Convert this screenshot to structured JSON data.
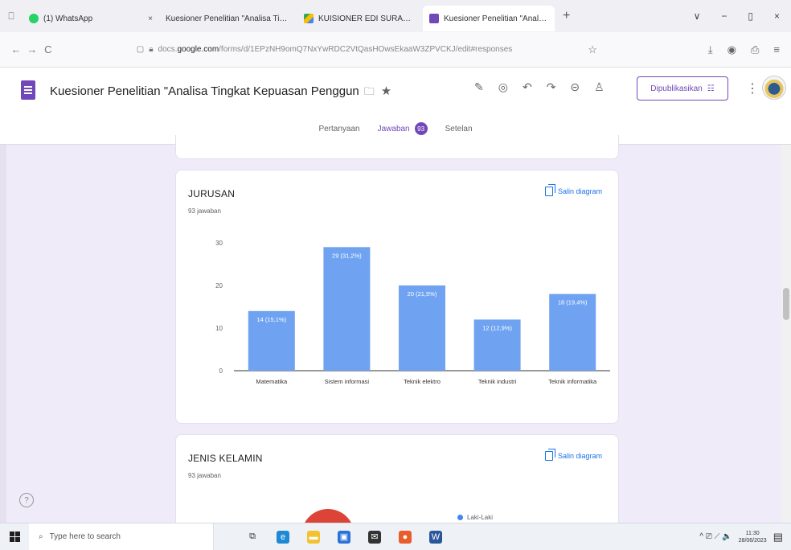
{
  "browser": {
    "tabs": [
      {
        "label": "(1) WhatsApp",
        "close": "×",
        "color": "#25d366",
        "active": false
      },
      {
        "label": "Kuesioner Penelitian \"Analisa Tingk: ×",
        "close": "",
        "color": "#ffffff",
        "active": false
      },
      {
        "label": "KUISIONER EDI SURADI - Goog ×",
        "close": "",
        "color": "#34a853",
        "active": false
      },
      {
        "label": "Kuesioner Penelitian \"Analisa Ti ×",
        "close": "",
        "color": "#7248b9",
        "active": true
      }
    ],
    "new_tab": "+",
    "window_controls": [
      "∨",
      "−",
      "▯",
      "×"
    ],
    "nav": {
      "back": "←",
      "forward": "→",
      "reload": "C"
    },
    "url_prefix": "docs.",
    "url_host": "google.com",
    "url_path": "/forms/d/1EPzNH9omQ7NxYwRDC2VtQasHOwsEkaaW3ZPVCKJ/edit#responses",
    "url_icons": [
      "☆",
      "⤓",
      "◉",
      "⎙",
      "≡"
    ]
  },
  "forms": {
    "title": "Kuesioner Penelitian \"Analisa Tingkat Kepuasan Penggun",
    "header_icons": [
      "palette-icon",
      "preview-icon",
      "undo-icon",
      "redo-icon",
      "link-icon",
      "add-collaborator-icon"
    ],
    "header_glyphs": [
      "✎",
      "◎",
      "↶",
      "↷",
      "⊝",
      "♙"
    ],
    "publish_label": "Dipublikasikan",
    "tabs": {
      "questions": "Pertanyaan",
      "responses": "Jawaban",
      "responses_count": "93",
      "settings": "Setelan"
    }
  },
  "help_glyph": "?",
  "jurusan": {
    "title": "JURUSAN",
    "count": "93 jawaban",
    "copy_label": "Salin diagram"
  },
  "gender": {
    "title": "JENIS KELAMIN",
    "count": "93 jawaban",
    "copy_label": "Salin diagram",
    "legend_male": "Laki-Laki",
    "colors": {
      "male": "#4285f4",
      "female": "#db4437"
    }
  },
  "chart_data": {
    "type": "bar",
    "title": "JURUSAN",
    "categories": [
      "Matematika",
      "Sistem informasi",
      "Teknik elektro",
      "Teknik industri",
      "Teknik informatika"
    ],
    "values": [
      14,
      29,
      20,
      12,
      18
    ],
    "data_labels": [
      "14 (15,1%)",
      "29 (31,2%)",
      "20 (21,5%)",
      "12 (12,9%)",
      "18 (19,4%)"
    ],
    "y_ticks": [
      0,
      10,
      20,
      30
    ],
    "ylim": [
      0,
      30
    ],
    "bar_color": "#6fa3f2",
    "grid": false
  },
  "taskbar": {
    "search_placeholder": "Type here to search",
    "apps": [
      {
        "name": "task-view",
        "glyph": "⧉",
        "color": "#eef2f7"
      },
      {
        "name": "edge",
        "glyph": "e",
        "color": "#1f8ad3"
      },
      {
        "name": "file-explorer",
        "glyph": "▬",
        "color": "#f2c230"
      },
      {
        "name": "store",
        "glyph": "▣",
        "color": "#2b72d6"
      },
      {
        "name": "mail",
        "glyph": "✉",
        "color": "#333333"
      },
      {
        "name": "firefox",
        "glyph": "●",
        "color": "#e85d2a"
      },
      {
        "name": "word",
        "glyph": "W",
        "color": "#2b579a"
      }
    ],
    "tray_glyphs": "^ ⎚ ⟋ 🔈",
    "time": "11:30",
    "date": "28/06/2023",
    "notif_glyph": "▤"
  }
}
